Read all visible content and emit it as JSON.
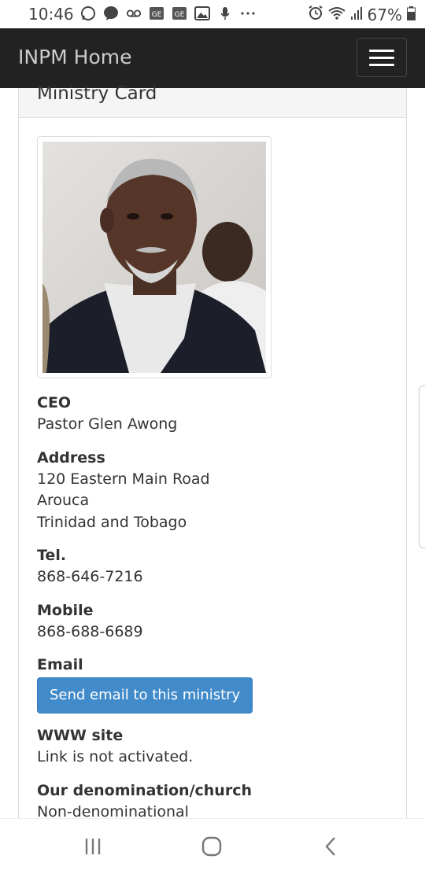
{
  "status_bar": {
    "time": "10:46",
    "battery": "67%",
    "left_icons": [
      "whatsapp-icon",
      "messenger-icon",
      "voicemail-icon",
      "ge-app-icon",
      "ge-app-icon",
      "gallery-icon",
      "mic-icon",
      "more-dots-icon"
    ],
    "right_icons": [
      "alarm-icon",
      "wifi-icon",
      "signal-icon",
      "battery-icon"
    ]
  },
  "navbar": {
    "brand": "INPM Home",
    "menu_icon": "hamburger-menu-icon"
  },
  "panel": {
    "heading": "Ministry Card",
    "photo_icon": "portrait-photo",
    "fields": {
      "ceo_label": "CEO",
      "ceo_value": "Pastor Glen Awong",
      "address_label": "Address",
      "address_line1": "120 Eastern Main Road",
      "address_line2": "Arouca",
      "address_line3": "Trinidad and Tobago",
      "tel_label": "Tel.",
      "tel_value": "868-646-7216",
      "mobile_label": "Mobile",
      "mobile_value": "868-688-6689",
      "email_label": "Email",
      "email_button": "Send email to this ministry",
      "www_label": "WWW site",
      "www_value": "Link is not activated.",
      "denomination_label": "Our denomination/church",
      "denomination_value": "Non-denominational"
    }
  },
  "colors": {
    "navbar_bg": "#222222",
    "button_bg": "#428bca",
    "panel_heading_bg": "#f5f5f5"
  },
  "system_nav": {
    "icons": [
      "recent-apps-icon",
      "home-icon",
      "back-icon"
    ]
  }
}
